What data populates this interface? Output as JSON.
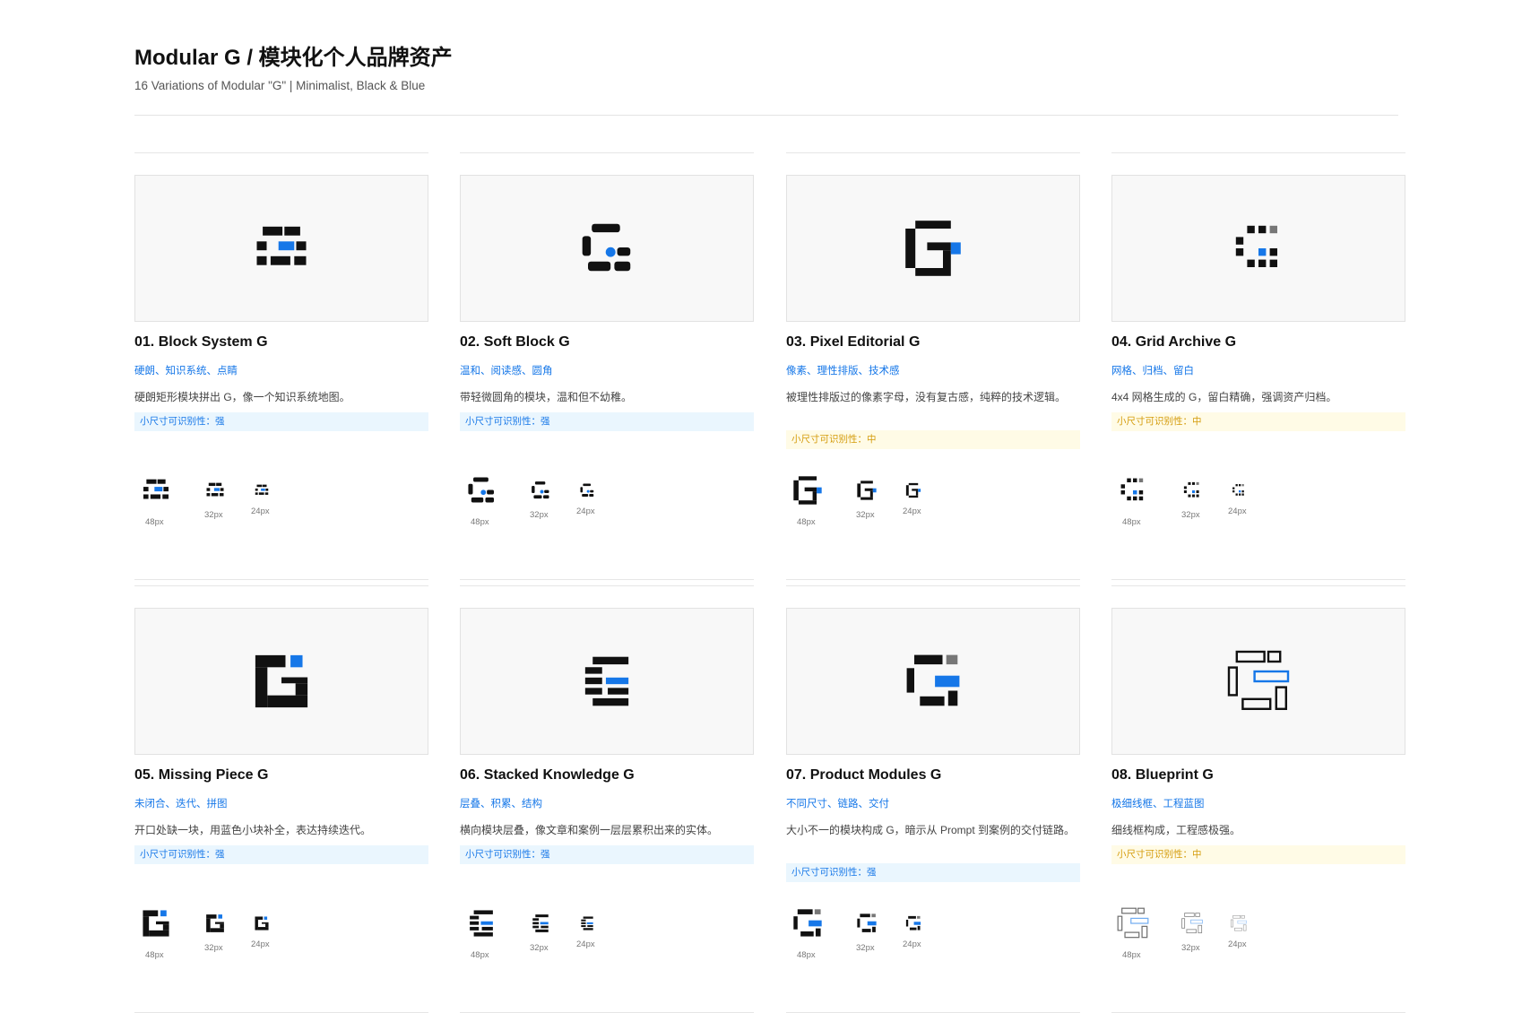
{
  "header": {
    "title": "Modular G / 模块化个人品牌资产",
    "subtitle": "16 Variations of Modular \"G\" | Minimalist, Black & Blue"
  },
  "colors": {
    "ink": "#111111",
    "blue": "#1677e8",
    "gray": "#777777"
  },
  "cards": [
    {
      "name": "01. Block System G",
      "tags": "硬朗、知识系统、点睛",
      "desc": "硬朗矩形模块拼出 G，像一个知识系统地图。",
      "badge": "小尺寸可识别性：强",
      "badge_level": "strong",
      "sizes": [
        "48px",
        "32px",
        "24px"
      ],
      "icon": "block-system-g-icon"
    },
    {
      "name": "02. Soft Block G",
      "tags": "温和、阅读感、圆角",
      "desc": "带轻微圆角的模块，温和但不幼稚。",
      "badge": "小尺寸可识别性：强",
      "badge_level": "strong",
      "sizes": [
        "48px",
        "32px",
        "24px"
      ],
      "icon": "soft-block-g-icon"
    },
    {
      "name": "03. Pixel Editorial G",
      "tags": "像素、理性排版、技术感",
      "desc": "被理性排版过的像素字母，没有复古感，纯粹的技术逻辑。",
      "badge": "小尺寸可识别性：中",
      "badge_level": "medium",
      "sizes": [
        "48px",
        "32px",
        "24px"
      ],
      "icon": "pixel-editorial-g-icon"
    },
    {
      "name": "04. Grid Archive G",
      "tags": "网格、归档、留白",
      "desc": "4x4 网格生成的 G，留白精确，强调资产归档。",
      "badge": "小尺寸可识别性：中",
      "badge_level": "medium",
      "sizes": [
        "48px",
        "32px",
        "24px"
      ],
      "icon": "grid-archive-g-icon"
    },
    {
      "name": "05. Missing Piece G",
      "tags": "未闭合、迭代、拼图",
      "desc": "开口处缺一块，用蓝色小块补全，表达持续迭代。",
      "badge": "小尺寸可识别性：强",
      "badge_level": "strong",
      "sizes": [
        "48px",
        "32px",
        "24px"
      ],
      "icon": "missing-piece-g-icon"
    },
    {
      "name": "06. Stacked Knowledge G",
      "tags": "层叠、积累、结构",
      "desc": "横向模块层叠，像文章和案例一层层累积出来的实体。",
      "badge": "小尺寸可识别性：强",
      "badge_level": "strong",
      "sizes": [
        "48px",
        "32px",
        "24px"
      ],
      "icon": "stacked-knowledge-g-icon"
    },
    {
      "name": "07. Product Modules G",
      "tags": "不同尺寸、链路、交付",
      "desc": "大小不一的模块构成 G，暗示从 Prompt 到案例的交付链路。",
      "badge": "小尺寸可识别性：强",
      "badge_level": "strong",
      "sizes": [
        "48px",
        "32px",
        "24px"
      ],
      "icon": "product-modules-g-icon"
    },
    {
      "name": "08. Blueprint G",
      "tags": "极细线框、工程蓝图",
      "desc": "细线框构成，工程感极强。",
      "badge": "小尺寸可识别性：中",
      "badge_level": "medium",
      "sizes": [
        "48px",
        "32px",
        "24px"
      ],
      "icon": "blueprint-g-icon"
    }
  ]
}
